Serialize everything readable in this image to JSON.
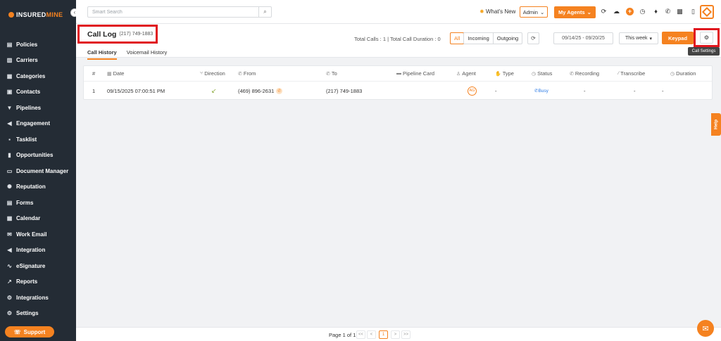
{
  "brand": {
    "name_prefix": "INSURED",
    "name_suffix": "MINE"
  },
  "sidebar": {
    "collapse_icon": "chevron-left-icon",
    "items": [
      {
        "label": "Policies",
        "icon": "policy-icon",
        "glyph": "▤"
      },
      {
        "label": "Carriers",
        "icon": "carrier-icon",
        "glyph": "▥"
      },
      {
        "label": "Categories",
        "icon": "category-icon",
        "glyph": "▦"
      },
      {
        "label": "Contacts",
        "icon": "contacts-icon",
        "glyph": "▣"
      },
      {
        "label": "Pipelines",
        "icon": "pipeline-icon",
        "glyph": "▼"
      },
      {
        "label": "Engagement",
        "icon": "megaphone-icon",
        "glyph": "◀"
      },
      {
        "label": "Tasklist",
        "icon": "tasklist-icon",
        "glyph": "▪"
      },
      {
        "label": "Opportunities",
        "icon": "bar-chart-icon",
        "glyph": "▮"
      },
      {
        "label": "Document Manager",
        "icon": "folder-icon",
        "glyph": "▭"
      },
      {
        "label": "Reputation",
        "icon": "reputation-icon",
        "glyph": "✺"
      },
      {
        "label": "Forms",
        "icon": "forms-icon",
        "glyph": "▤"
      },
      {
        "label": "Calendar",
        "icon": "calendar-icon",
        "glyph": "▦"
      },
      {
        "label": "Work Email",
        "icon": "mail-icon",
        "glyph": "✉"
      },
      {
        "label": "Integration",
        "icon": "megaphone-icon",
        "glyph": "◀"
      },
      {
        "label": "eSignature",
        "icon": "signature-icon",
        "glyph": "∿"
      },
      {
        "label": "Reports",
        "icon": "line-chart-icon",
        "glyph": "↗"
      },
      {
        "label": "Integrations",
        "icon": "gears-icon",
        "glyph": "⚙"
      },
      {
        "label": "Settings",
        "icon": "gear-icon",
        "glyph": "⚙"
      }
    ],
    "support_label": "Support"
  },
  "topbar": {
    "search_placeholder": "Smart Search",
    "whats_new": "What's New",
    "admin_label": "Admin",
    "my_agents": "My Agents"
  },
  "header": {
    "title": "Call Log",
    "phone": "(217) 749-1883",
    "tabs": [
      "Call History",
      "Voicemail History"
    ],
    "stats": "Total Calls : 1  |  Total Call Duration : 0",
    "filters": [
      "All",
      "Incoming",
      "Outgoing"
    ],
    "date_range": "09/14/25 - 09/20/25",
    "range_preset": "This week",
    "keypad": "Keypad",
    "settings_tooltip": "Call Settings"
  },
  "table": {
    "columns": [
      "#",
      "Date",
      "Direction",
      "From",
      "To",
      "Pipeline Card",
      "Agent",
      "Type",
      "Status",
      "Recording",
      "Transcribe",
      "Duration"
    ],
    "rows": [
      {
        "index": "1",
        "date": "09/15/2025 07:00:51 PM",
        "direction": "↙",
        "from": "(469) 896-2631",
        "to": "(217) 749-1883",
        "pipeline_card": "",
        "agent": "AG",
        "type": "-",
        "status": "Busy",
        "recording": "-",
        "transcribe": "-",
        "duration": "-"
      }
    ]
  },
  "footer": {
    "page_text": "Page 1 of 1",
    "first": "<<",
    "prev": "<",
    "current": "1",
    "next": ">",
    "last": ">>"
  },
  "help_label": "Help"
}
